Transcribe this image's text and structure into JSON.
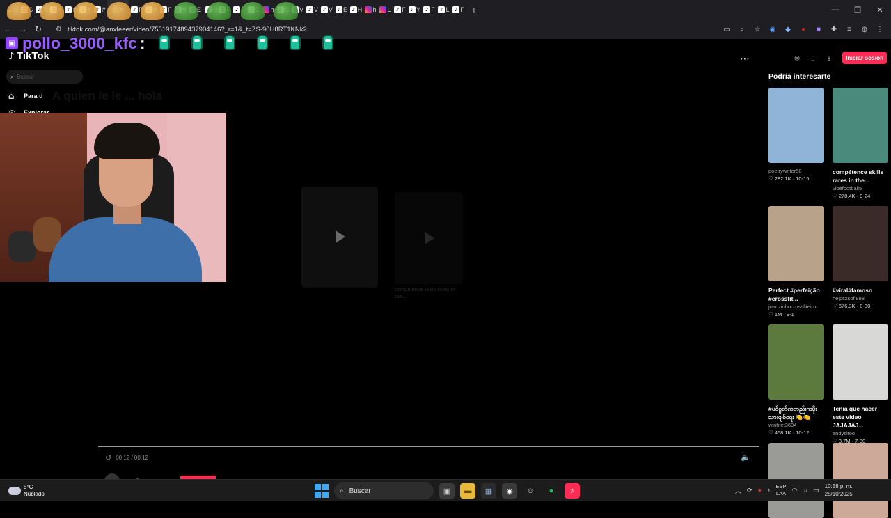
{
  "browser": {
    "url": "tiktok.com/@anxfeeer/video/7551917489437904146?_r=1&_t=ZS-90H8RT1KNk2",
    "tab_letters": [
      "C",
      "T",
      "#",
      "#",
      "#",
      "#",
      "F",
      "#",
      "F",
      "V",
      "E",
      "I",
      "F",
      "F",
      "C",
      "h",
      "C",
      "V",
      "V",
      "V",
      "E",
      "H",
      "h",
      "L",
      "F",
      "Y",
      "F",
      "L",
      "F"
    ],
    "active_tab_letter": "E"
  },
  "overlay": {
    "chat_username": "pollo_3000_kfc",
    "chat_colon": ":"
  },
  "tiktok": {
    "logo_text": "TikTok",
    "search_placeholder": "Buscar",
    "nav": [
      {
        "label": "Para ti",
        "icon": "home-icon"
      },
      {
        "label": "Explorar",
        "icon": "compass-icon"
      }
    ],
    "ghost_caption": "A quien le le ... hola",
    "login_button": "Iniciar sesión",
    "recs_title": "Podría interesarte",
    "next_card_caption": "compétence skills rares in the...",
    "player": {
      "time": "00:12 / 00:12",
      "progress": 1.0,
      "author": "anxfeeer"
    },
    "recommendations": [
      {
        "title": "",
        "author": "poetrywriter58",
        "likes": "282.1K",
        "date": "10-15",
        "thumb_color": "#8fb4d8"
      },
      {
        "title": "compétence skills rares in the...",
        "author": "vibefootball5",
        "likes": "278.4K",
        "date": "9-24",
        "thumb_color": "#4a8a7c"
      },
      {
        "title": "Perfect #perfeição #crossfit...",
        "author": "joaozinhocrossfiteiro",
        "likes": "1M",
        "date": "9-1",
        "thumb_color": "#b9a28a"
      },
      {
        "title": "#viral#famoso",
        "author": "helpsxsofi898",
        "likes": "676.3K",
        "date": "8-30",
        "thumb_color": "#3a2a28"
      },
      {
        "title": "#ပင်စွတ်ကတည်းကပိုးသားဖျစ်ရေး 🍋🍋",
        "author": "winhtet3694",
        "likes": "458.1K",
        "date": "10-12",
        "thumb_color": "#5d7a3e"
      },
      {
        "title": "Tenia que hacer este video JAJAJAJ...",
        "author": "andysitoo",
        "likes": "3.7M",
        "date": "7-30",
        "thumb_color": "#d8d8d6"
      },
      {
        "title": "",
        "author": "",
        "likes": "",
        "date": "",
        "thumb_color": "#9a9a96"
      },
      {
        "title": "",
        "author": "",
        "likes": "",
        "date": "",
        "thumb_color": "#cda99a"
      }
    ]
  },
  "taskbar": {
    "temperature": "5°C",
    "weather": "Nublado",
    "search_label": "Buscar",
    "lang_line1": "ESP",
    "lang_line2": "LAA",
    "time": "10:58 p. m.",
    "date": "25/10/2025"
  }
}
